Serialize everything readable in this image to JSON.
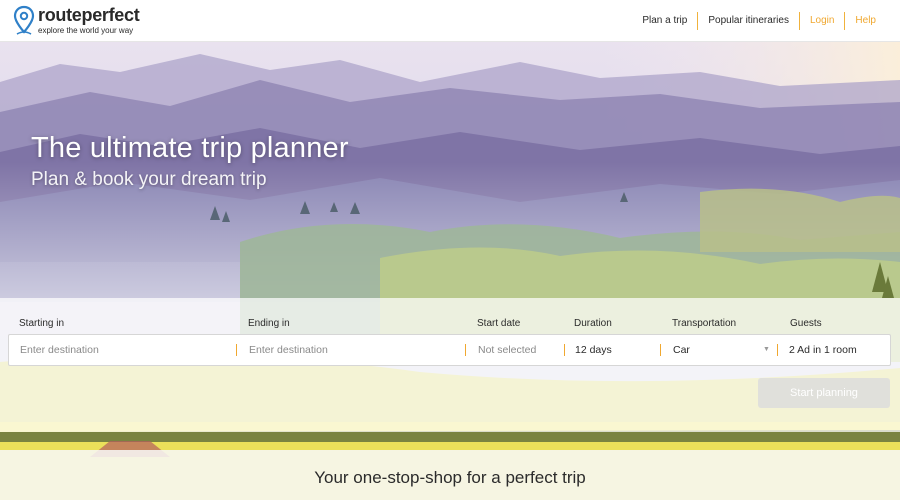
{
  "brand": {
    "name": "routeperfect",
    "tagline": "explore the world your way",
    "accent_color": "#f0a830",
    "pin_color": "#2f80c8"
  },
  "nav": {
    "items": [
      {
        "label": "Plan a trip"
      },
      {
        "label": "Popular itineraries"
      },
      {
        "label": "Login"
      },
      {
        "label": "Help"
      }
    ]
  },
  "hero": {
    "title": "The ultimate trip planner",
    "subtitle": "Plan & book your dream trip"
  },
  "search": {
    "starting_label": "Starting in",
    "starting_placeholder": "Enter destination",
    "ending_label": "Ending in",
    "ending_placeholder": "Enter destination",
    "start_date_label": "Start date",
    "start_date_value": "Not selected",
    "duration_label": "Duration",
    "duration_value": "12 days",
    "transportation_label": "Transportation",
    "transportation_value": "Car",
    "guests_label": "Guests",
    "guests_value": "2 Ad in 1 room",
    "submit_label": "Start planning"
  },
  "section": {
    "heading": "Your one-stop-shop for a perfect trip"
  }
}
